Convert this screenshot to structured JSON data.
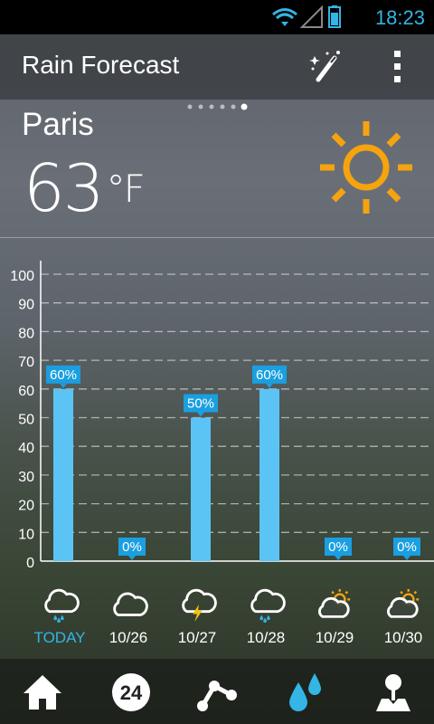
{
  "status": {
    "time": "18:23"
  },
  "app": {
    "title": "Rain Forecast"
  },
  "weather": {
    "city": "Paris",
    "temp": "63",
    "unit": "°F",
    "page_count": 6,
    "page_active": 6
  },
  "chart_data": {
    "type": "bar",
    "categories": [
      "TODAY",
      "10/26",
      "10/27",
      "10/28",
      "10/29",
      "10/30"
    ],
    "values": [
      60,
      0,
      50,
      60,
      0,
      0
    ],
    "value_labels": [
      "60%",
      "0%",
      "50%",
      "60%",
      "0%",
      "0%"
    ],
    "ylim": [
      0,
      100
    ],
    "yticks": [
      "0",
      "10",
      "20",
      "30",
      "40",
      "50",
      "60",
      "70",
      "80",
      "90",
      "100"
    ],
    "grid": true,
    "bar_color": "#5bc4f5",
    "label_color": "#1a9fe0"
  },
  "days": [
    {
      "label": "TODAY",
      "icon": "rain-cloud-icon",
      "active": true
    },
    {
      "label": "10/26",
      "icon": "cloud-icon",
      "active": false
    },
    {
      "label": "10/27",
      "icon": "thunder-cloud-icon",
      "active": false
    },
    {
      "label": "10/28",
      "icon": "rain-cloud-icon",
      "active": false
    },
    {
      "label": "10/29",
      "icon": "partly-cloudy-icon",
      "active": false
    },
    {
      "label": "10/30",
      "icon": "partly-cloudy-icon",
      "active": false
    }
  ],
  "nav": [
    {
      "icon": "home-icon"
    },
    {
      "icon": "24h-icon",
      "text": "24"
    },
    {
      "icon": "graph-icon"
    },
    {
      "icon": "rain-drops-icon",
      "active": true
    },
    {
      "icon": "location-map-icon"
    }
  ],
  "colors": {
    "accent": "#33b5e5",
    "sun": "#f5a30f"
  }
}
